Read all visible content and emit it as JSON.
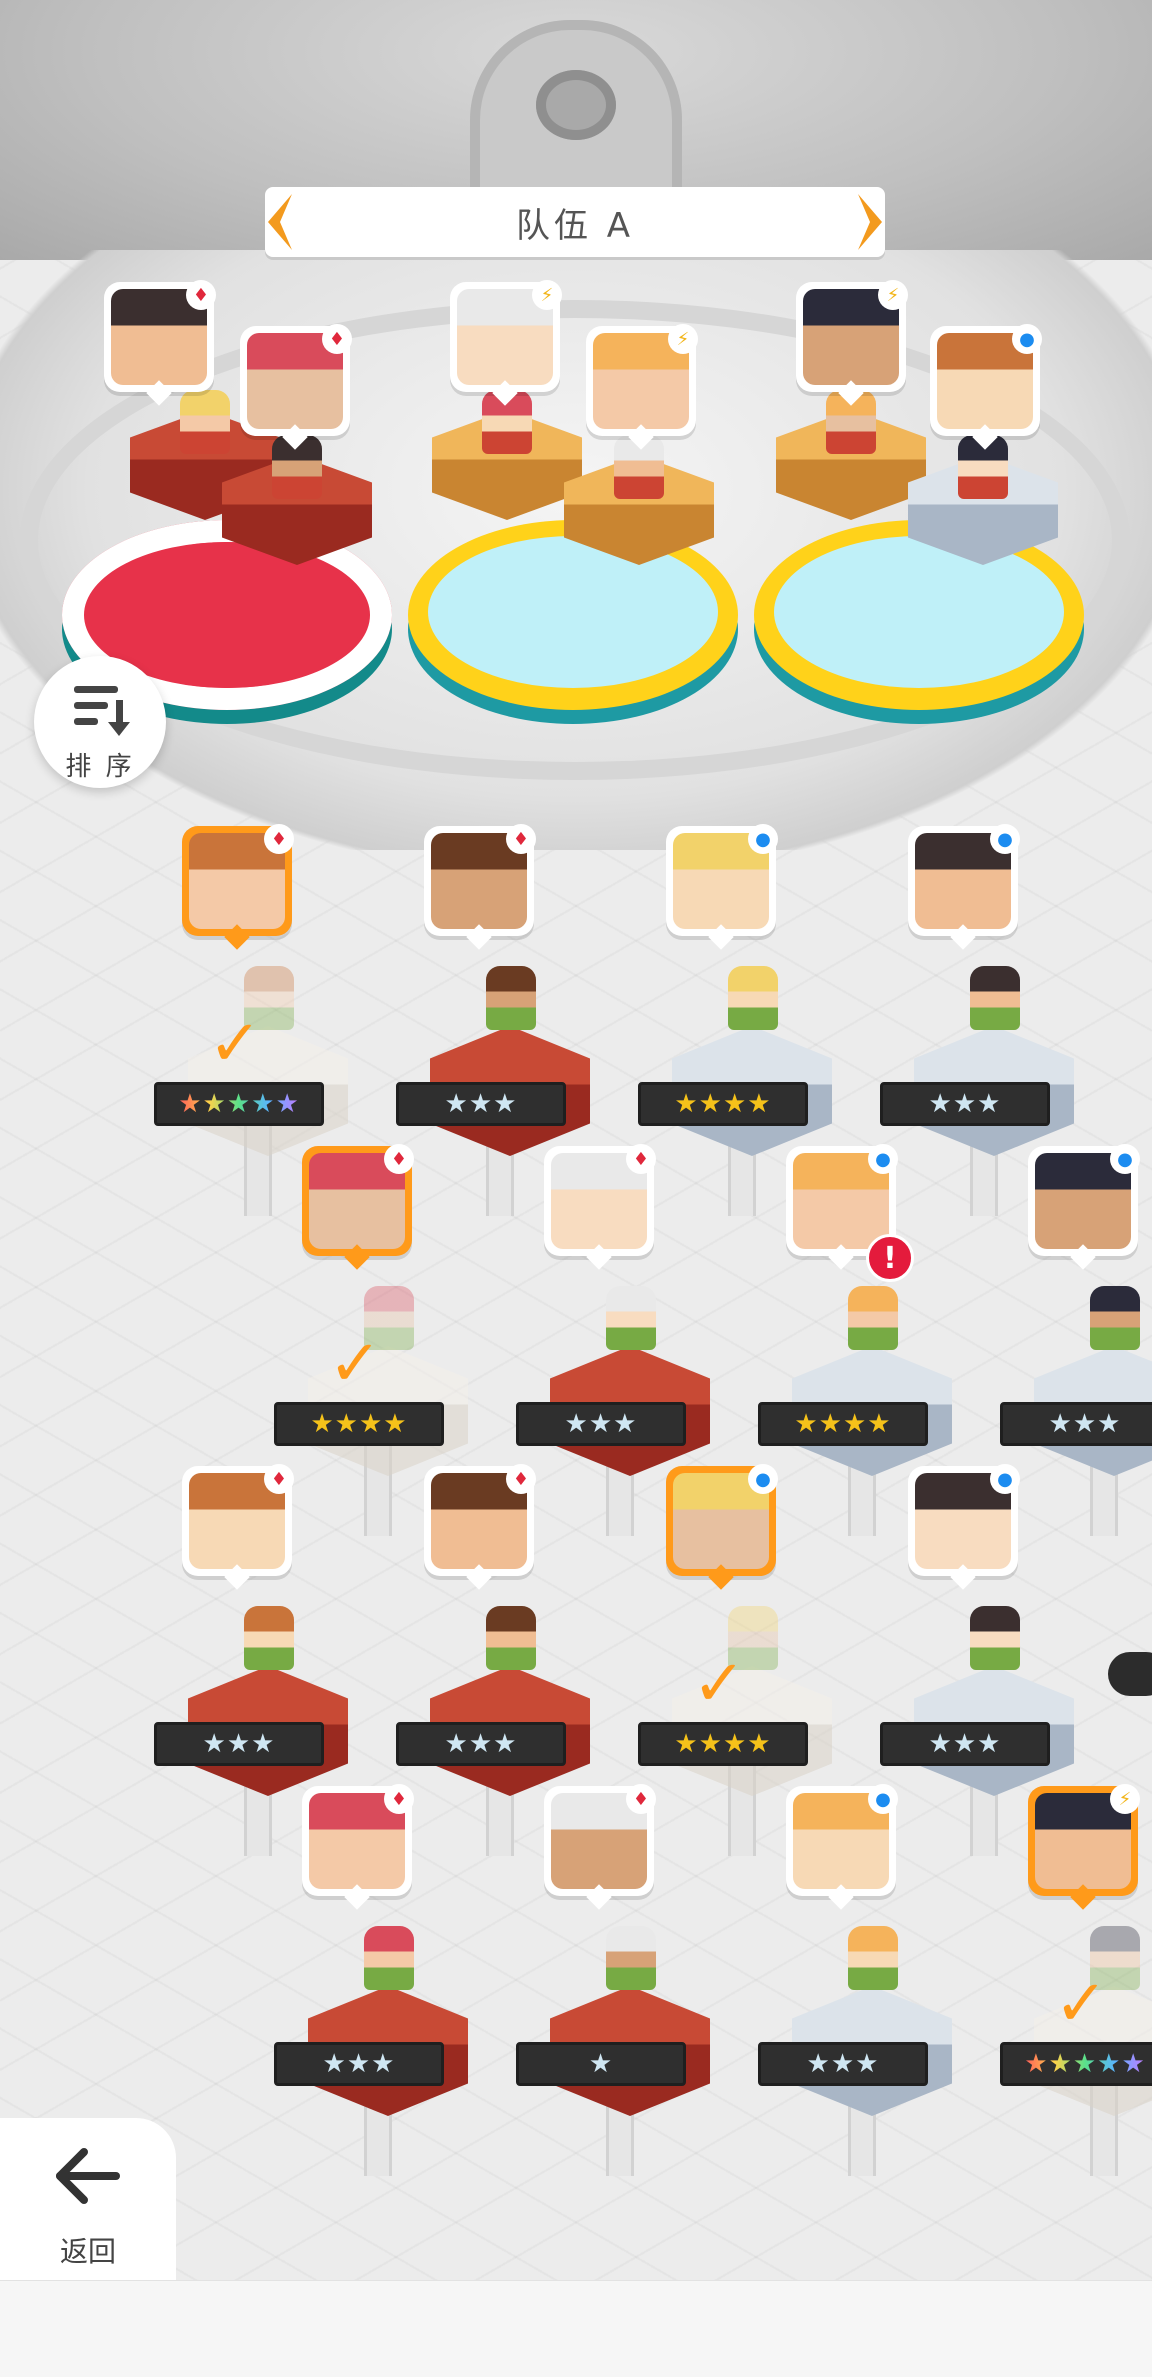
{
  "team": {
    "title": "队伍 A",
    "prev_icon": "chevron-left",
    "next_icon": "chevron-right"
  },
  "sort": {
    "label": "排 序",
    "icon": "sort-icon"
  },
  "back": {
    "label": "返回",
    "icon": "arrow-left-icon"
  },
  "colors": {
    "accent": "#ff9a1a",
    "fire": "#e0283c",
    "light": "#f2b416",
    "water": "#1c8cf0",
    "star_gold": "#f5c21a",
    "star_silver": "#cfe6f2"
  },
  "team_slots": [
    {
      "element": "fire",
      "element_icon": "♦",
      "ped": "red"
    },
    {
      "element": "fire",
      "element_icon": "♦",
      "ped": "red"
    },
    {
      "element": "light",
      "element_icon": "⚡",
      "ped": "gold"
    },
    {
      "element": "light",
      "element_icon": "⚡",
      "ped": "gold"
    },
    {
      "element": "light",
      "element_icon": "⚡",
      "ped": "gold"
    },
    {
      "element": "water",
      "element_icon": "●",
      "ped": "blue"
    }
  ],
  "roster": [
    {
      "element": "fire",
      "element_icon": "♦",
      "stars": "★★★★★",
      "star_type": "rainbow",
      "selected": true,
      "checked": true,
      "ped": "white"
    },
    {
      "element": "fire",
      "element_icon": "♦",
      "stars": "★★★",
      "star_type": "silver",
      "selected": false,
      "checked": false,
      "ped": "red"
    },
    {
      "element": "water",
      "element_icon": "●",
      "stars": "★★★★",
      "star_type": "gold",
      "selected": false,
      "checked": false,
      "ped": "blue"
    },
    {
      "element": "water",
      "element_icon": "●",
      "stars": "★★★",
      "star_type": "silver",
      "selected": false,
      "checked": false,
      "ped": "blue"
    },
    {
      "element": "fire",
      "element_icon": "♦",
      "stars": "★★★★",
      "star_type": "gold",
      "selected": true,
      "checked": true,
      "ped": "white"
    },
    {
      "element": "fire",
      "element_icon": "♦",
      "stars": "★★★",
      "star_type": "silver",
      "selected": false,
      "checked": false,
      "ped": "red"
    },
    {
      "element": "water",
      "element_icon": "●",
      "stars": "★★★★",
      "star_type": "gold",
      "selected": false,
      "checked": false,
      "ped": "blue",
      "alert": "!"
    },
    {
      "element": "water",
      "element_icon": "●",
      "stars": "★★★",
      "star_type": "silver",
      "selected": false,
      "checked": false,
      "ped": "blue"
    },
    {
      "element": "fire",
      "element_icon": "♦",
      "stars": "★★★",
      "star_type": "silver",
      "selected": false,
      "checked": false,
      "ped": "red"
    },
    {
      "element": "fire",
      "element_icon": "♦",
      "stars": "★★★",
      "star_type": "silver",
      "selected": false,
      "checked": false,
      "ped": "red"
    },
    {
      "element": "water",
      "element_icon": "●",
      "stars": "★★★★",
      "star_type": "gold",
      "selected": true,
      "checked": true,
      "ped": "white"
    },
    {
      "element": "water",
      "element_icon": "●",
      "stars": "★★★",
      "star_type": "silver",
      "selected": false,
      "checked": false,
      "ped": "blue"
    },
    {
      "element": "fire",
      "element_icon": "♦",
      "stars": "★★★",
      "star_type": "silver",
      "selected": false,
      "checked": false,
      "ped": "red"
    },
    {
      "element": "fire",
      "element_icon": "♦",
      "stars": "★",
      "star_type": "silver",
      "selected": false,
      "checked": false,
      "ped": "red"
    },
    {
      "element": "water",
      "element_icon": "●",
      "stars": "★★★",
      "star_type": "silver",
      "selected": false,
      "checked": false,
      "ped": "blue"
    },
    {
      "element": "light",
      "element_icon": "⚡",
      "stars": "★★★★★",
      "star_type": "rainbow",
      "selected": true,
      "checked": true,
      "ped": "white"
    }
  ],
  "check_mark": "✓"
}
